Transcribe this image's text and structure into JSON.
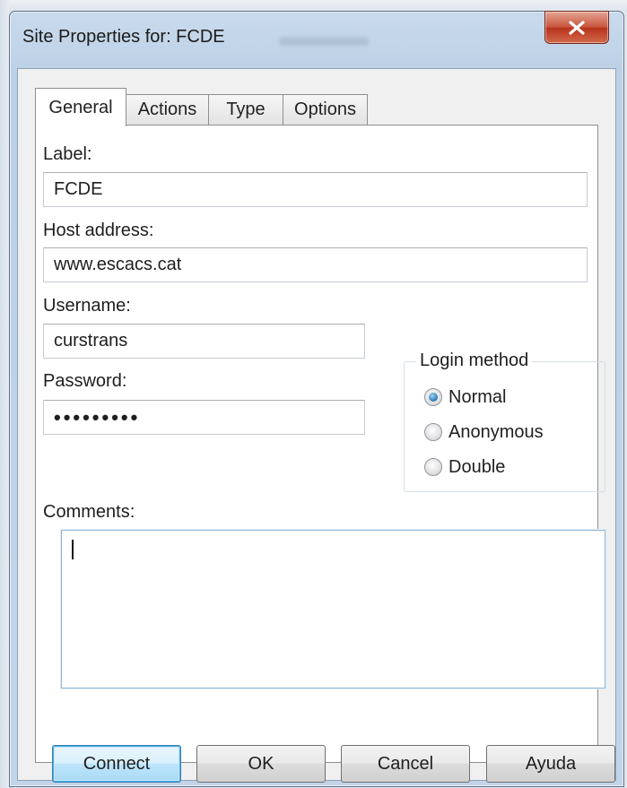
{
  "window": {
    "title": "Site Properties for: FCDE",
    "close_icon": "close-icon"
  },
  "tabs": [
    {
      "label": "General",
      "active": true
    },
    {
      "label": "Actions",
      "active": false
    },
    {
      "label": "Type",
      "active": false
    },
    {
      "label": "Options",
      "active": false
    }
  ],
  "general": {
    "label_caption": "Label:",
    "label_value": "FCDE",
    "host_caption": "Host address:",
    "host_value": "www.escacs.cat",
    "username_caption": "Username:",
    "username_value": "curstrans",
    "password_caption": "Password:",
    "password_value": "•••••••••",
    "comments_caption": "Comments:",
    "comments_value": ""
  },
  "login_method": {
    "title": "Login method",
    "options": [
      {
        "label": "Normal",
        "checked": true
      },
      {
        "label": "Anonymous",
        "checked": false
      },
      {
        "label": "Double",
        "checked": false
      }
    ]
  },
  "buttons": {
    "connect": "Connect",
    "ok": "OK",
    "cancel": "Cancel",
    "help": "Ayuda"
  },
  "colors": {
    "accent": "#2b77b7",
    "close_button": "#c8553c"
  }
}
